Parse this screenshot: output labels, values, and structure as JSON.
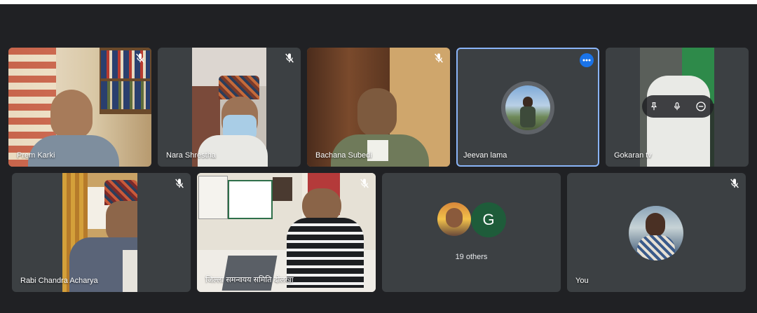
{
  "meeting": {
    "participants": [
      {
        "name": "Prem Karki",
        "muted": true
      },
      {
        "name": "Nara Shrestha",
        "muted": true
      },
      {
        "name": "Bachana Subedi",
        "muted": true
      },
      {
        "name": "Jeevan lama",
        "muted": false,
        "highlighted": true
      },
      {
        "name": "Gokaran tv",
        "muted": false
      },
      {
        "name": "Rabi Chandra Acharya",
        "muted": true
      },
      {
        "name": "जिल्ला समन्वयय समिति दोलखा",
        "muted": true
      },
      {
        "name": "You",
        "muted": true
      }
    ],
    "others": {
      "count_label": "19 others",
      "avatar_letter": "G"
    },
    "colors": {
      "background": "#202124",
      "tile": "#3c4043",
      "highlight_border": "#8ab4f8",
      "accent": "#1a73e8",
      "g_avatar": "#1e5c3a"
    },
    "icons": {
      "mute": "mic-off-icon",
      "more": "more-options-icon",
      "pin": "pin-icon",
      "mic": "mic-icon",
      "remove": "minus-circle-icon"
    }
  }
}
